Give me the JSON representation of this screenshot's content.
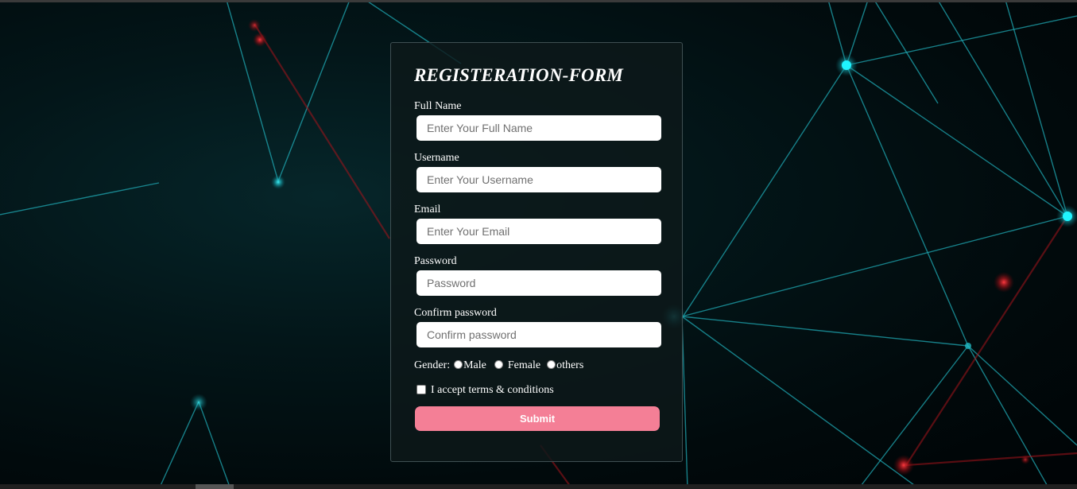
{
  "form": {
    "title": "REGISTERATION-FORM",
    "fields": [
      {
        "label": "Full Name",
        "placeholder": "Enter Your Full Name",
        "value": ""
      },
      {
        "label": "Username",
        "placeholder": "Enter Your Username",
        "value": ""
      },
      {
        "label": "Email",
        "placeholder": "Enter Your Email",
        "value": ""
      },
      {
        "label": "Password",
        "placeholder": "Password",
        "value": ""
      },
      {
        "label": "Confirm password",
        "placeholder": "Confirm password",
        "value": ""
      }
    ],
    "gender": {
      "label": "Gender:",
      "options": [
        "Male",
        "Female",
        "others"
      ]
    },
    "terms_label": "I accept terms & conditions",
    "submit_label": "Submit"
  },
  "colors": {
    "submit": "#f47f96",
    "network_node": "#00e5ee",
    "network_node_red": "#e8262e"
  }
}
